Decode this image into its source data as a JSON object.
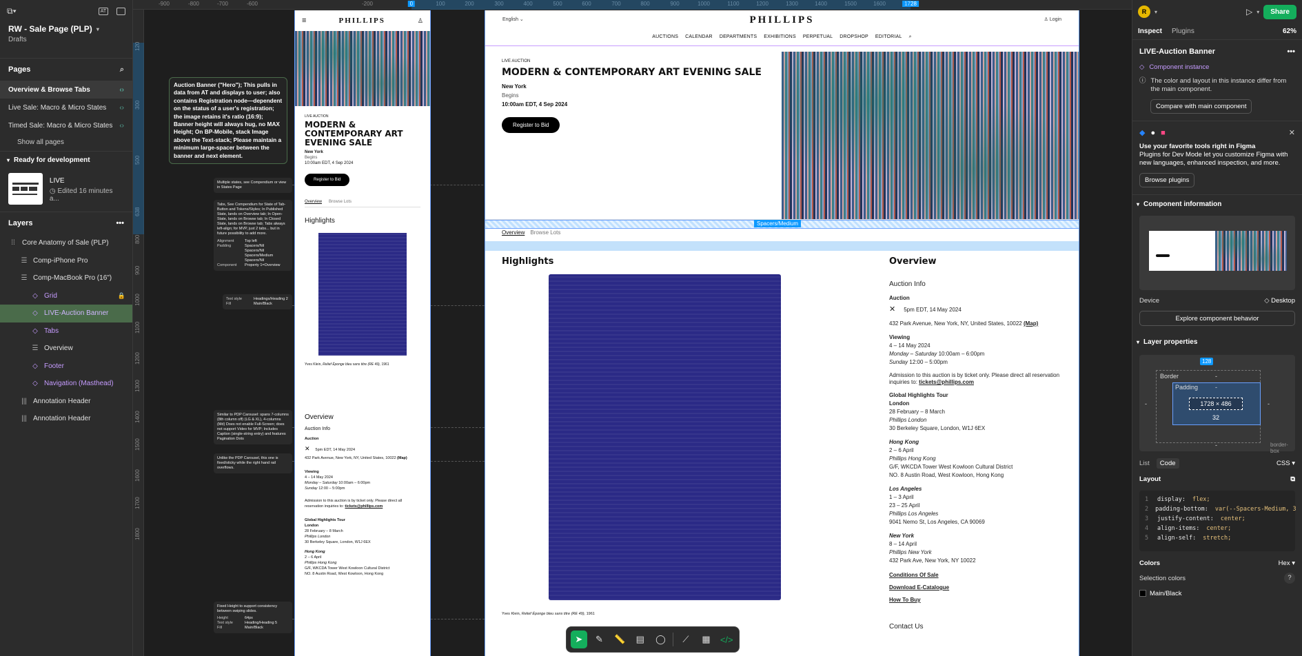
{
  "file": {
    "title": "RW - Sale Page (PLP)",
    "subtitle": "Drafts"
  },
  "pages": {
    "heading": "Pages",
    "items": [
      {
        "label": "Overview & Browse Tabs",
        "active": true
      },
      {
        "label": "Live Sale: Macro & Micro States",
        "active": false
      },
      {
        "label": "Timed Sale: Macro & Micro States",
        "active": false
      }
    ],
    "show_all": "Show all pages"
  },
  "ready": {
    "label": "Ready for development",
    "card_title": "LIVE",
    "card_sub": "Edited 16 minutes a..."
  },
  "layers": {
    "heading": "Layers",
    "items": [
      {
        "label": "Core Anatomy of Sale (PLP)",
        "icon": "section-icon",
        "indent": 0,
        "type": "frame"
      },
      {
        "label": "Comp-iPhone Pro",
        "icon": "frame-icon",
        "indent": 1,
        "type": "frame"
      },
      {
        "label": "Comp-MacBook Pro (16\")",
        "icon": "frame-icon",
        "indent": 1,
        "type": "frame"
      },
      {
        "label": "Grid",
        "icon": "instance-icon",
        "indent": 2,
        "type": "comp",
        "locked": true
      },
      {
        "label": "LIVE-Auction Banner",
        "icon": "instance-icon",
        "indent": 2,
        "type": "comp",
        "selected": true
      },
      {
        "label": "Tabs",
        "icon": "instance-icon",
        "indent": 2,
        "type": "comp"
      },
      {
        "label": "Overview",
        "icon": "frame-icon",
        "indent": 2,
        "type": "frame"
      },
      {
        "label": "Footer",
        "icon": "instance-icon",
        "indent": 2,
        "type": "comp"
      },
      {
        "label": "Navigation (Masthead)",
        "icon": "instance-icon",
        "indent": 2,
        "type": "comp"
      },
      {
        "label": "Annotation Header",
        "icon": "annotation-icon",
        "indent": 1,
        "type": "frame"
      },
      {
        "label": "Annotation Header",
        "icon": "annotation-icon",
        "indent": 1,
        "type": "frame"
      }
    ]
  },
  "ruler": {
    "top": [
      "-900",
      "-800",
      "-700",
      "-600",
      "-200",
      "0",
      "100",
      "200",
      "300",
      "400",
      "500",
      "600",
      "700",
      "800",
      "900",
      "1000",
      "1100",
      "1200",
      "1300",
      "1400",
      "1500",
      "1600",
      "1728"
    ],
    "left": [
      "120",
      "300",
      "500",
      "638",
      "800",
      "900",
      "1000",
      "1100",
      "1200",
      "1300",
      "1400",
      "1500",
      "1600",
      "1700",
      "1800"
    ]
  },
  "annotations": {
    "main": "Auction Banner (\"Hero\"); This pulls in data from AT and displays to user; also contains Registration node—dependent on the status of a user's registration; the image retains it's ratio (16:9); Banner height will always hug, no MAX Height; On BP-Mobile, stack Image above the Text-stack; Please maintain a minimum large-spacer between the banner and next element.",
    "states": "Multiple states, see Compendium or view in States Page",
    "tabs": "Tabs, See Compendium for State of Tab-Button and Tokens/Styles; In Published State, lands on Overview tab; In Open-State, lands on Browse tab; In Closed State, lands on Browse tab; Tabs always left-align; for MVP, just 2 tabs... but in future possibility to add more.",
    "tabs_props": [
      {
        "k": "Alignment",
        "v": "Top left"
      },
      {
        "k": "Padding",
        "v": "Spacers/Nil"
      },
      {
        "k": "",
        "v": "Spacers/Nil"
      },
      {
        "k": "",
        "v": "Spacers/Medium"
      },
      {
        "k": "",
        "v": "Spacers/Nil"
      },
      {
        "k": "Component",
        "v": "Property 1=Overview"
      }
    ],
    "style_props": [
      {
        "k": "Text style",
        "v": "Headings/Heading 2"
      },
      {
        "k": "Fill",
        "v": "Main/Black"
      }
    ],
    "carousel": "Similar to PDP Carousel: spans 7-columns (8th column off) (LG & XL), 4-columns (Md) Does not enable Full-Screen; does not support Video for MVP; Includes Caption (single-string entry) and features Pagination Dots",
    "sticky": "Unlike the PDP Carousel, this one is fixed/sticky while the right hand rail overflows.",
    "fixed": "Fixed Height to support consistency between swiping slides.",
    "fixed_props": [
      {
        "k": "Height",
        "v": "64px"
      },
      {
        "k": "Text style",
        "v": "Heading/Heading 5"
      },
      {
        "k": "Fill",
        "v": "Main/Black"
      }
    ]
  },
  "site": {
    "logo": "PHILLIPS",
    "language": "English",
    "login": "Login",
    "nav": [
      "AUCTIONS",
      "CALENDAR",
      "DEPARTMENTS",
      "EXHIBITIONS",
      "PERPETUAL",
      "DROPSHOP",
      "EDITORIAL"
    ],
    "kicker": "LIVE AUCTION",
    "title": "MODERN & CONTEMPORARY ART EVENING SALE",
    "location": "New York",
    "begins_label": "Begins",
    "begins": "10:00am EDT, 4 Sep 2024",
    "register": "Register to Bid",
    "tabs": [
      "Overview",
      "Browse Lots"
    ],
    "spacer_tag": "Spacers/Medium",
    "highlights": "Highlights",
    "caption_artist": "Yves Klein, ",
    "caption_work": "Relief Éponge bleu sans titre (RE 49), ",
    "caption_year": "1961"
  },
  "overview": {
    "title": "Overview",
    "auction_info": "Auction Info",
    "auction_label": "Auction",
    "auction_time": "5pm EDT, 14 May 2024",
    "address": "432 Park Avenue, New York, NY, United States, 10022",
    "map": "(Map)",
    "viewing_label": "Viewing",
    "viewing_dates": "4 – 14 May 2024",
    "viewing_l1": "Monday – Saturday",
    "viewing_l1b": "10:00am – 6:00pm",
    "viewing_l2": "Sunday",
    "viewing_l2b": "12:00 – 5:00pm",
    "admission": "Admission to this auction is by ticket only. Please direct all reservation inquiries to:",
    "email": "tickets@phillips.com",
    "tour_label": "Global Highlights Tour",
    "london": "London",
    "london_dates": "28 February – 8 March",
    "london_venue": "Phillips London",
    "london_addr": "30 Berkeley Square, London, W1J 6EX",
    "hk": "Hong Kong",
    "hk_dates": "2 – 6 April",
    "hk_venue": "Phillips Hong Kong",
    "hk_addr1": "G/F, WKCDA Tower West Kowloon Cultural District",
    "hk_addr2": "NO. 8 Austin Road, West Kowloon, Hong Kong",
    "la": "Los Angeles",
    "la_d1": "1 – 3 April",
    "la_d2": "23 – 25 April",
    "la_venue": "Phillips Los Angeles",
    "la_addr": "9041 Nemo St, Los Angeles, CA 90069",
    "ny": "New York",
    "ny_dates": "8 – 14 April",
    "ny_venue": "Phillips New York",
    "ny_addr": "432 Park Ave, New York, NY 10022",
    "links": [
      "Conditions Of Sale",
      "Download E-Catalogue",
      "How To Buy"
    ],
    "contact": "Contact Us"
  },
  "right": {
    "avatar": "R",
    "share": "Share",
    "tabs": [
      "Inspect",
      "Plugins"
    ],
    "zoom": "62%",
    "layer_name": "LIVE-Auction Banner",
    "component_instance": "Component instance",
    "instance_note": "The color and layout in this instance differ from the main component.",
    "compare_btn": "Compare with main component",
    "dev_title": "Use your favorite tools right in Figma",
    "dev_text": "Plugins for Dev Mode let you customize Figma with new languages, enhanced inspection, and more.",
    "browse_plugins": "Browse plugins",
    "component_info": "Component information",
    "device_label": "Device",
    "device_value": "Desktop",
    "explore_btn": "Explore component behavior",
    "layer_props": "Layer properties",
    "box": {
      "top_badge": "128",
      "border": "Border",
      "padding": "Padding",
      "size": "1728 × 486",
      "bottom": "32",
      "dash": "-"
    },
    "border_box": "border-box",
    "list_code": [
      "List",
      "Code"
    ],
    "lang": "CSS",
    "layout": "Layout",
    "code": [
      {
        "n": "1",
        "p": "display:",
        "v": "flex;"
      },
      {
        "n": "2",
        "p": "padding-bottom:",
        "v": "var(--Spacers-Medium, 3"
      },
      {
        "n": "3",
        "p": "justify-content:",
        "v": "center;"
      },
      {
        "n": "4",
        "p": "align-items:",
        "v": "center;"
      },
      {
        "n": "5",
        "p": "align-self:",
        "v": "stretch;"
      }
    ],
    "colors": "Colors",
    "color_format": "Hex",
    "selection_colors": "Selection colors",
    "color_main": "Main/Black",
    "help": "?"
  }
}
